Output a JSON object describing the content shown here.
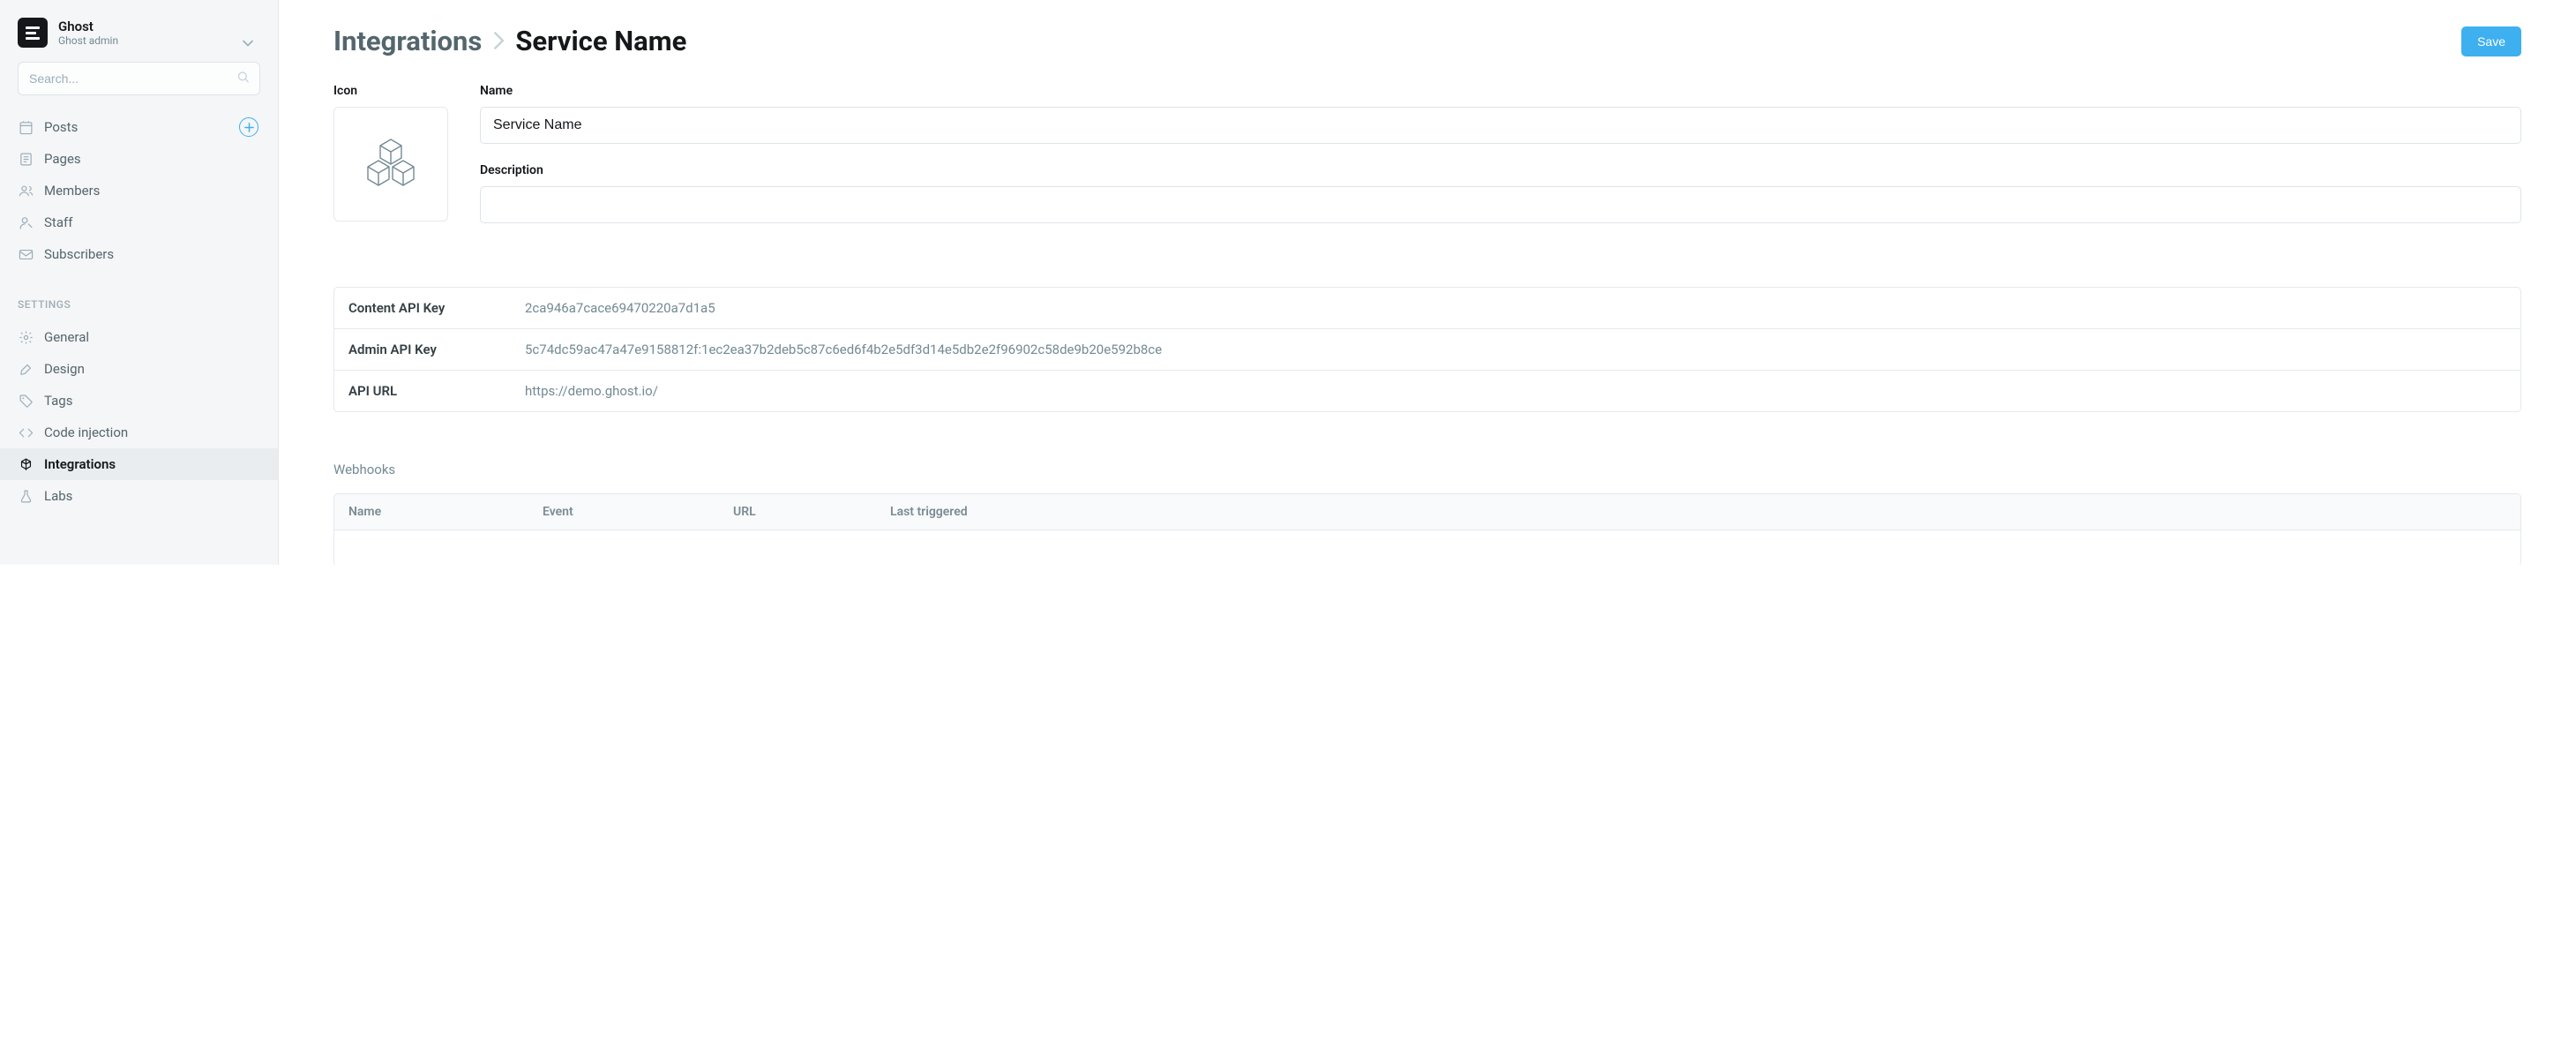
{
  "site": {
    "title": "Ghost",
    "subtitle": "Ghost admin"
  },
  "search": {
    "placeholder": "Search..."
  },
  "nav": {
    "items": [
      {
        "label": "Posts",
        "has_add": true
      },
      {
        "label": "Pages"
      },
      {
        "label": "Members"
      },
      {
        "label": "Staff"
      },
      {
        "label": "Subscribers"
      }
    ],
    "settings_label": "SETTINGS",
    "settings_items": [
      {
        "label": "General"
      },
      {
        "label": "Design"
      },
      {
        "label": "Tags"
      },
      {
        "label": "Code injection"
      },
      {
        "label": "Integrations",
        "active": true
      },
      {
        "label": "Labs"
      }
    ]
  },
  "header": {
    "breadcrumb_root": "Integrations",
    "breadcrumb_current": "Service Name",
    "save_label": "Save"
  },
  "form": {
    "icon_label": "Icon",
    "name_label": "Name",
    "name_value": "Service Name",
    "description_label": "Description",
    "description_value": ""
  },
  "api": {
    "rows": [
      {
        "label": "Content API Key",
        "value": "2ca946a7cace69470220a7d1a5"
      },
      {
        "label": "Admin API Key",
        "value": "5c74dc59ac47a47e9158812f:1ec2ea37b2deb5c87c6ed6f4b2e5df3d14e5db2e2f96902c58de9b20e592b8ce"
      },
      {
        "label": "API URL",
        "value": "https://demo.ghost.io/"
      }
    ]
  },
  "webhooks": {
    "title": "Webhooks",
    "columns": {
      "name": "Name",
      "event": "Event",
      "url": "URL",
      "last_triggered": "Last triggered"
    }
  }
}
